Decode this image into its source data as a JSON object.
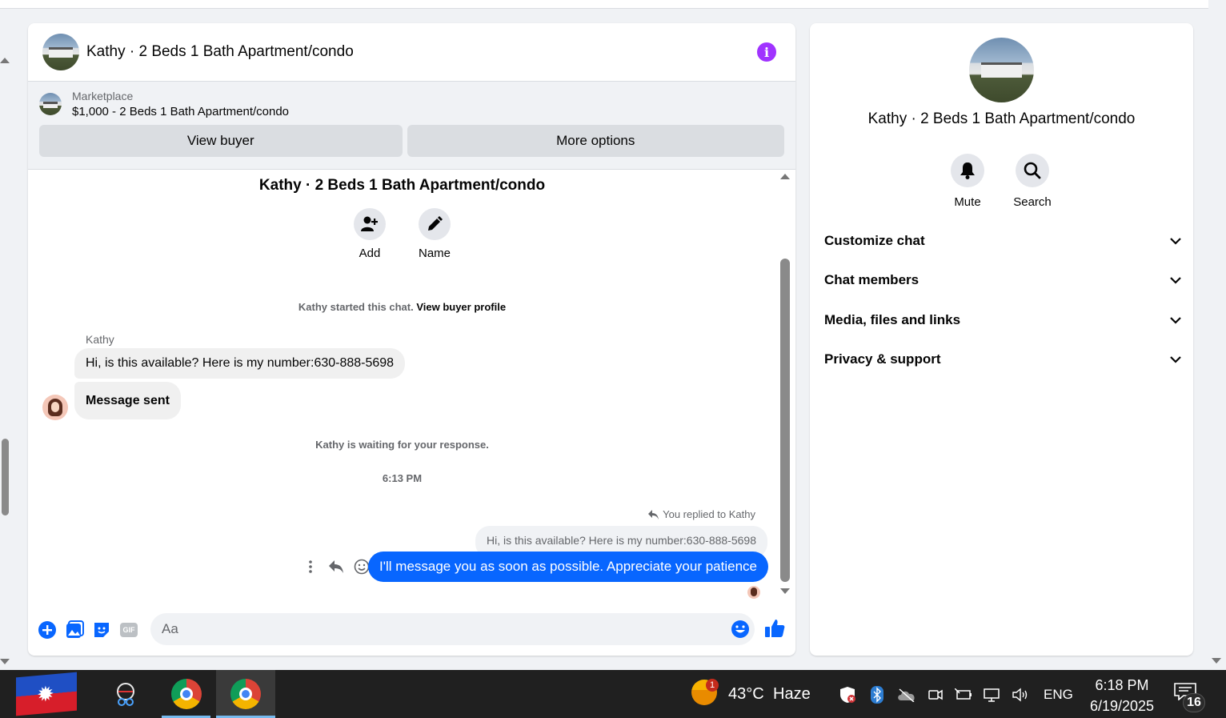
{
  "chat": {
    "header_title": "Kathy · 2 Beds 1 Bath Apartment/condo",
    "marketplace_label": "Marketplace",
    "listing_title": "$1,000 - 2 Beds 1 Bath Apartment/condo",
    "view_buyer_label": "View buyer",
    "more_options_label": "More options",
    "conversation_title": "Kathy · 2 Beds 1 Bath Apartment/condo",
    "add_label": "Add",
    "name_label": "Name",
    "started_text": "Kathy started this chat.",
    "view_profile_link": "View buyer profile",
    "sender_name": "Kathy",
    "messages_in": [
      "Hi, is this available? Here is my number:630-888-5698",
      "Message sent"
    ],
    "waiting_text": "Kathy is waiting for your response.",
    "timestamp": "6:13 PM",
    "replied_text": "You replied to Kathy",
    "quoted_text": "Hi, is this available? Here is my number:630-888-5698",
    "reply_text": "I'll message you as soon as possible. Appreciate your patience",
    "input_placeholder": "Aa",
    "accent_color": "#0866ff"
  },
  "info": {
    "title": "Kathy · 2 Beds 1 Bath Apartment/condo",
    "mute_label": "Mute",
    "search_label": "Search",
    "sections": [
      "Customize chat",
      "Chat members",
      "Media, files and links",
      "Privacy & support"
    ]
  },
  "taskbar": {
    "weather_temp": "43°C",
    "weather_desc": "Haze",
    "weather_badge": "1",
    "language": "ENG",
    "time": "6:18 PM",
    "date": "6/19/2025",
    "notification_count": "16"
  }
}
